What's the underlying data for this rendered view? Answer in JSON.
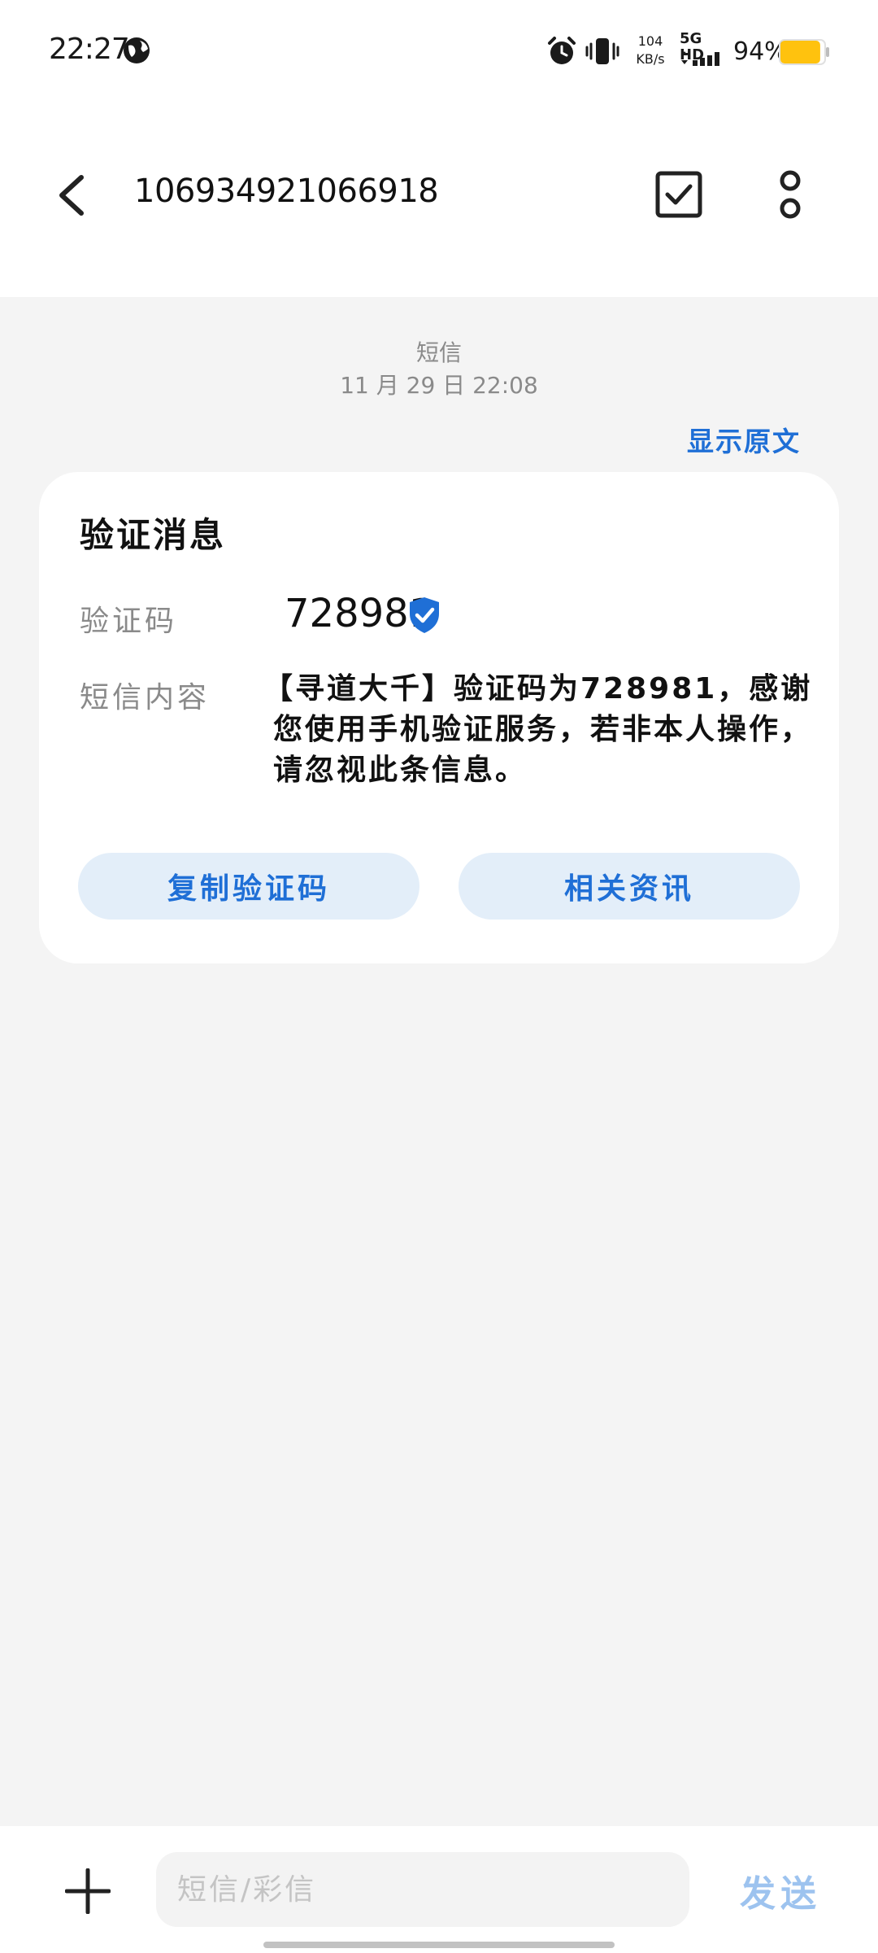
{
  "status_bar": {
    "time": "22:27",
    "net_speed_value": "104",
    "net_speed_unit": "KB/s",
    "network_label": "5G HD",
    "battery_percent": "94%",
    "battery_level": 0.94,
    "battery_color": "#ffc20e"
  },
  "header": {
    "title": "106934921066918"
  },
  "message_meta": {
    "type": "短信",
    "date": "11 月 29 日 22:08",
    "show_original": "显示原文"
  },
  "card": {
    "title": "验证消息",
    "code_label": "验证码",
    "code_value": "728981",
    "content_label": "短信内容",
    "content_text": "【寻道大千】验证码为728981，感谢您使用手机验证服务，若非本人操作，请忽视此条信息。",
    "copy_button": "复制验证码",
    "related_button": "相关资讯"
  },
  "composer": {
    "placeholder": "短信/彩信",
    "value": "",
    "send_label": "发送"
  },
  "colors": {
    "accent": "#1f6fd6",
    "button_bg": "#e3eef9",
    "send_disabled": "#9dc3ef",
    "background": "#f4f4f4"
  },
  "icons": {
    "status_globe": "globe-icon",
    "status_alarm": "alarm-icon",
    "status_vibrate": "vibrate-icon",
    "status_signal": "signal-icon",
    "status_battery": "battery-icon",
    "back": "back-arrow-icon",
    "select": "checkbox-icon",
    "more": "more-vertical-icon",
    "verified": "verified-shield-icon",
    "add": "plus-icon"
  }
}
